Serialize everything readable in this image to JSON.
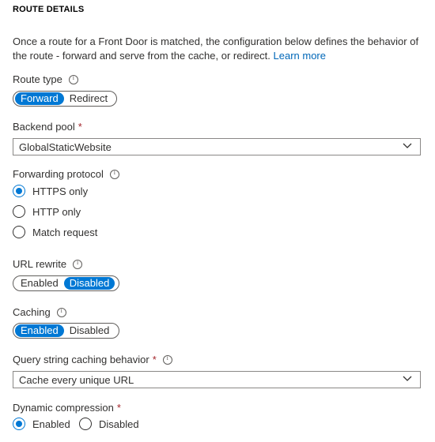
{
  "section": {
    "title": "ROUTE DETAILS"
  },
  "description": {
    "text": "Once a route for a Front Door is matched, the configuration below defines the behavior of the route - forward and serve from the cache, or redirect.",
    "link": "Learn more"
  },
  "route_type": {
    "label": "Route type",
    "options": [
      "Forward",
      "Redirect"
    ],
    "selected": "Forward"
  },
  "backend_pool": {
    "label": "Backend pool",
    "required": "*",
    "value": "GlobalStaticWebsite"
  },
  "forwarding_protocol": {
    "label": "Forwarding protocol",
    "options": [
      "HTTPS only",
      "HTTP only",
      "Match request"
    ],
    "selected": "HTTPS only"
  },
  "url_rewrite": {
    "label": "URL rewrite",
    "options": [
      "Enabled",
      "Disabled"
    ],
    "selected": "Disabled"
  },
  "caching": {
    "label": "Caching",
    "options": [
      "Enabled",
      "Disabled"
    ],
    "selected": "Enabled"
  },
  "query_string": {
    "label": "Query string caching behavior",
    "required": "*",
    "value": "Cache every unique URL"
  },
  "dynamic_compression": {
    "label": "Dynamic compression",
    "required": "*",
    "options": [
      "Enabled",
      "Disabled"
    ],
    "selected": "Enabled"
  },
  "colors": {
    "accent": "#0078d4",
    "link": "#0067b8",
    "required": "#a4262c"
  },
  "icons": {
    "info": "info-icon",
    "dropdown": "chevron-down-icon"
  }
}
